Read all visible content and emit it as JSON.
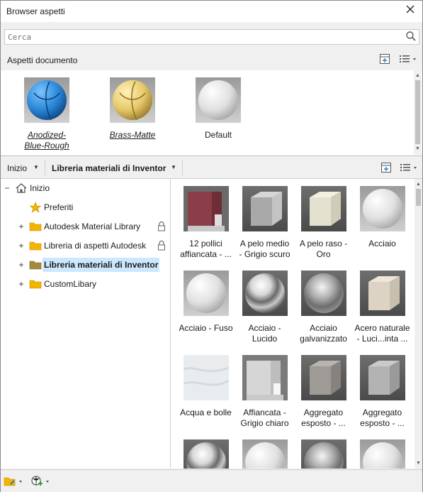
{
  "window": {
    "title": "Browser aspetti"
  },
  "search": {
    "placeholder": "Cerca"
  },
  "document_section": {
    "title": "Aspetti documento",
    "items": [
      {
        "label": "Anodized-Blue-Rough",
        "line1": "Anodized-",
        "line2": "Blue-Rough"
      },
      {
        "label": "Brass-Matte"
      },
      {
        "label": "Default"
      }
    ]
  },
  "navbar": {
    "home": "Inizio",
    "library": "Libreria materiali di Inventor"
  },
  "tree": {
    "items": [
      {
        "label": "Inizio"
      },
      {
        "label": "Preferiti"
      },
      {
        "label": "Autodesk Material Library"
      },
      {
        "label": "Libreria di aspetti Autodesk"
      },
      {
        "label": "Libreria materiali di Inventor"
      },
      {
        "label": "CustomLibary"
      }
    ]
  },
  "materials": [
    {
      "l1": "12 pollici",
      "l2": "affiancata - ..."
    },
    {
      "l1": "A pelo medio",
      "l2": "- Grigio scuro"
    },
    {
      "l1": "A pelo raso -",
      "l2": "Oro"
    },
    {
      "l1": "Acciaio",
      "l2": ""
    },
    {
      "l1": "Acciaio - Fuso",
      "l2": ""
    },
    {
      "l1": "Acciaio -",
      "l2": "Lucido"
    },
    {
      "l1": "Acciaio",
      "l2": "galvanizzato"
    },
    {
      "l1": "Acero naturale",
      "l2": "- Luci...inta ..."
    },
    {
      "l1": "Acqua e bolle",
      "l2": ""
    },
    {
      "l1": "Affiancata -",
      "l2": "Grigio chiaro"
    },
    {
      "l1": "Aggregato",
      "l2": "esposto - ..."
    },
    {
      "l1": "Aggregato",
      "l2": "esposto - ..."
    }
  ],
  "colors": {
    "selection": "#cce8ff",
    "folder": "#f4b400",
    "accent": "#1a7fd4"
  }
}
